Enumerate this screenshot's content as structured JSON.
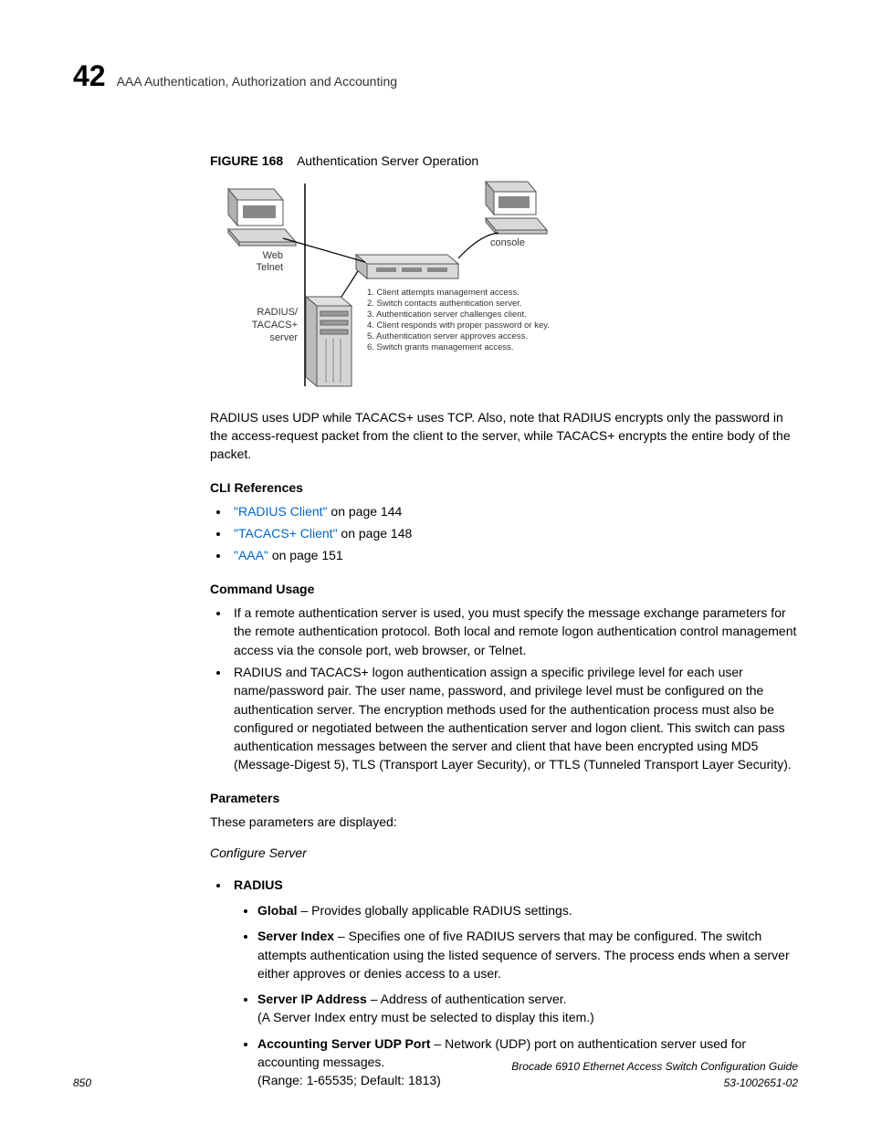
{
  "header": {
    "chapter_num": "42",
    "chapter_title": "AAA Authentication, Authorization and Accounting"
  },
  "figure": {
    "label": "FIGURE 168",
    "title": "Authentication Server Operation",
    "labels": {
      "web_telnet_l1": "Web",
      "web_telnet_l2": "Telnet",
      "radius_l1": "RADIUS/",
      "radius_l2": "TACACS+",
      "radius_l3": "server",
      "console": "console",
      "step1": "1. Client attempts management access.",
      "step2": "2. Switch contacts authentication server.",
      "step3": "3. Authentication server challenges client.",
      "step4": "4. Client responds with proper password or key.",
      "step5": "5. Authentication server approves access.",
      "step6": "6. Switch grants management access."
    }
  },
  "para1": "RADIUS uses UDP while TACACS+ uses TCP. Also, note that RADIUS encrypts only the password in the access-request packet from the client to the server, while TACACS+ encrypts the entire body of the packet.",
  "cli_ref": {
    "heading": "CLI References",
    "items": [
      {
        "link": "\"RADIUS Client\"",
        "suffix": " on page 144"
      },
      {
        "link": "\"TACACS+ Client\"",
        "suffix": " on page 148"
      },
      {
        "link": "\"AAA\"",
        "suffix": " on page 151"
      }
    ]
  },
  "cmd_usage": {
    "heading": "Command Usage",
    "items": [
      "If a remote authentication server is used, you must specify the message exchange parameters for the remote authentication protocol. Both local and remote logon authentication control management access via the console port, web browser, or Telnet.",
      "RADIUS and TACACS+ logon authentication assign a specific privilege level for each user name/password pair. The user name, password, and privilege level must be configured on the authentication server. The encryption methods used for the authentication process must also be configured or negotiated between the authentication server and logon client. This switch can pass authentication messages between the server and client that have been encrypted using MD5 (Message-Digest 5), TLS (Transport Layer Security), or TTLS (Tunneled Transport Layer Security)."
    ]
  },
  "params": {
    "heading": "Parameters",
    "intro": "These parameters are displayed:",
    "cfg_server": "Configure Server",
    "radius_label": "RADIUS",
    "sub": [
      {
        "b": "Global",
        "t": " – Provides globally applicable RADIUS settings."
      },
      {
        "b": "Server Index",
        "t": " – Specifies one of five RADIUS servers that may be configured. The switch attempts authentication using the listed sequence of servers. The process ends when a server either approves or denies access to a user."
      },
      {
        "b": "Server IP Address",
        "t": " – Address of authentication server.",
        "extra": "(A Server Index entry must be selected to display this item.)"
      },
      {
        "b": "Accounting Server UDP Port",
        "t": " – Network (UDP) port on authentication server used for accounting messages.",
        "extra": "(Range: 1-65535; Default: 1813)"
      }
    ]
  },
  "footer": {
    "page": "850",
    "doc_title": "Brocade 6910 Ethernet Access Switch Configuration Guide",
    "doc_id": "53-1002651-02"
  }
}
